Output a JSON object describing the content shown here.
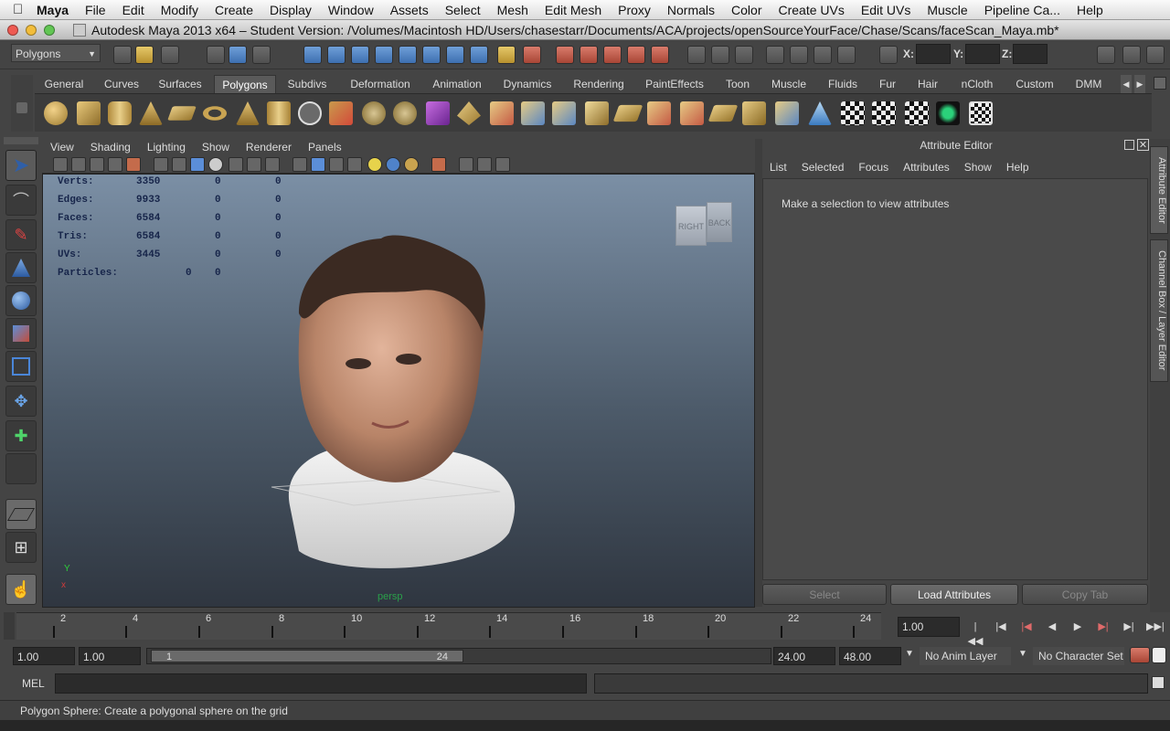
{
  "mac_menubar": {
    "app": "Maya",
    "items": [
      "File",
      "Edit",
      "Modify",
      "Create",
      "Display",
      "Window",
      "Assets",
      "Select",
      "Mesh",
      "Edit Mesh",
      "Proxy",
      "Normals",
      "Color",
      "Create UVs",
      "Edit UVs",
      "Muscle",
      "Pipeline Ca...",
      "Help"
    ]
  },
  "window": {
    "title": "Autodesk Maya 2013 x64 – Student Version: /Volumes/Macintosh HD/Users/chasestarr/Documents/ACA/projects/openSourceYourFace/Chase/Scans/faceScan_Maya.mb*"
  },
  "status_line": {
    "menuset": "Polygons",
    "x_label": "X:",
    "y_label": "Y:",
    "z_label": "Z:",
    "x_value": "",
    "y_value": "",
    "z_value": ""
  },
  "shelf": {
    "tabs": [
      "General",
      "Curves",
      "Surfaces",
      "Polygons",
      "Subdivs",
      "Deformation",
      "Animation",
      "Dynamics",
      "Rendering",
      "PaintEffects",
      "Toon",
      "Muscle",
      "Fluids",
      "Fur",
      "Hair",
      "nCloth",
      "Custom",
      "DMM"
    ],
    "active_tab": "Polygons"
  },
  "viewport": {
    "menus": [
      "View",
      "Shading",
      "Lighting",
      "Show",
      "Renderer",
      "Panels"
    ],
    "hud": [
      {
        "label": "Verts:",
        "v1": "3350",
        "v2": "0",
        "v3": "0"
      },
      {
        "label": "Edges:",
        "v1": "9933",
        "v2": "0",
        "v3": "0"
      },
      {
        "label": "Faces:",
        "v1": "6584",
        "v2": "0",
        "v3": "0"
      },
      {
        "label": "Tris:",
        "v1": "6584",
        "v2": "0",
        "v3": "0"
      },
      {
        "label": "UVs:",
        "v1": "3445",
        "v2": "0",
        "v3": "0"
      }
    ],
    "particles_label": "Particles:",
    "particles_v1": "0",
    "particles_v2": "0",
    "camera_name": "persp",
    "viewcube_right": "RIGHT",
    "viewcube_back": "BACK",
    "axis_x": "x",
    "axis_y": "Y"
  },
  "attribute_editor": {
    "title": "Attribute Editor",
    "menus": [
      "List",
      "Selected",
      "Focus",
      "Attributes",
      "Show",
      "Help"
    ],
    "message": "Make a selection to view attributes",
    "buttons": {
      "select": "Select",
      "load": "Load Attributes",
      "copy": "Copy Tab"
    }
  },
  "side_tabs": {
    "attribute_editor": "Attribute Editor",
    "channel_box": "Channel Box / Layer Editor"
  },
  "time_slider": {
    "ticks": [
      "2",
      "4",
      "6",
      "8",
      "10",
      "12",
      "14",
      "16",
      "18",
      "20",
      "22",
      "24"
    ],
    "current_time": "1.00"
  },
  "range_slider": {
    "start_time": "1.00",
    "playback_start": "1.00",
    "range_start_label": "1",
    "range_end_label": "24",
    "playback_end": "24.00",
    "end_time": "48.00",
    "anim_layer": "No Anim Layer",
    "character_set": "No Character Set"
  },
  "command_line": {
    "label": "MEL",
    "value": ""
  },
  "help_line": {
    "text": "Polygon Sphere: Create a polygonal sphere on the grid"
  }
}
